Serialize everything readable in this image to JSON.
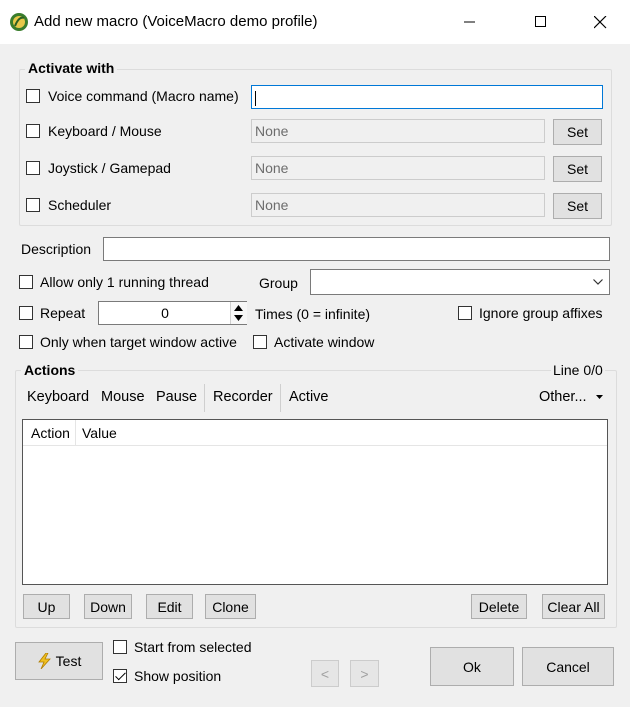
{
  "window": {
    "title": "Add new macro (VoiceMacro demo profile)",
    "controls": {
      "minimize": "minimize",
      "maximize": "maximize",
      "close": "close"
    }
  },
  "activate": {
    "group_label": "Activate with",
    "voice_label": "Voice command (Macro name)",
    "voice_value": "",
    "keyboard_label": "Keyboard / Mouse",
    "keyboard_value": "None",
    "joystick_label": "Joystick / Gamepad",
    "joystick_value": "None",
    "scheduler_label": "Scheduler",
    "scheduler_value": "None",
    "set_label": "Set"
  },
  "options": {
    "description_label": "Description",
    "description_value": "",
    "allow_thread_label": "Allow only 1 running thread",
    "group_label": "Group",
    "group_value": "",
    "repeat_label": "Repeat",
    "repeat_value": "0",
    "times_label": "Times (0 = infinite)",
    "ignore_affixes_label": "Ignore group affixes",
    "only_target_label": "Only when target window active",
    "activate_window_label": "Activate window"
  },
  "actions": {
    "group_label": "Actions",
    "line_status": "Line 0/0",
    "toolbar": {
      "keyboard": "Keyboard",
      "mouse": "Mouse",
      "pause": "Pause",
      "recorder": "Recorder",
      "active": "Active",
      "other": "Other..."
    },
    "columns": [
      "Action",
      "Value"
    ],
    "rows": [],
    "buttons": {
      "up": "Up",
      "down": "Down",
      "edit": "Edit",
      "clone": "Clone",
      "delete": "Delete",
      "clear_all": "Clear All"
    }
  },
  "footer": {
    "test_label": "Test",
    "start_from_selected": "Start from selected",
    "show_position": "Show position",
    "prev": "<",
    "next": ">",
    "ok": "Ok",
    "cancel": "Cancel"
  }
}
